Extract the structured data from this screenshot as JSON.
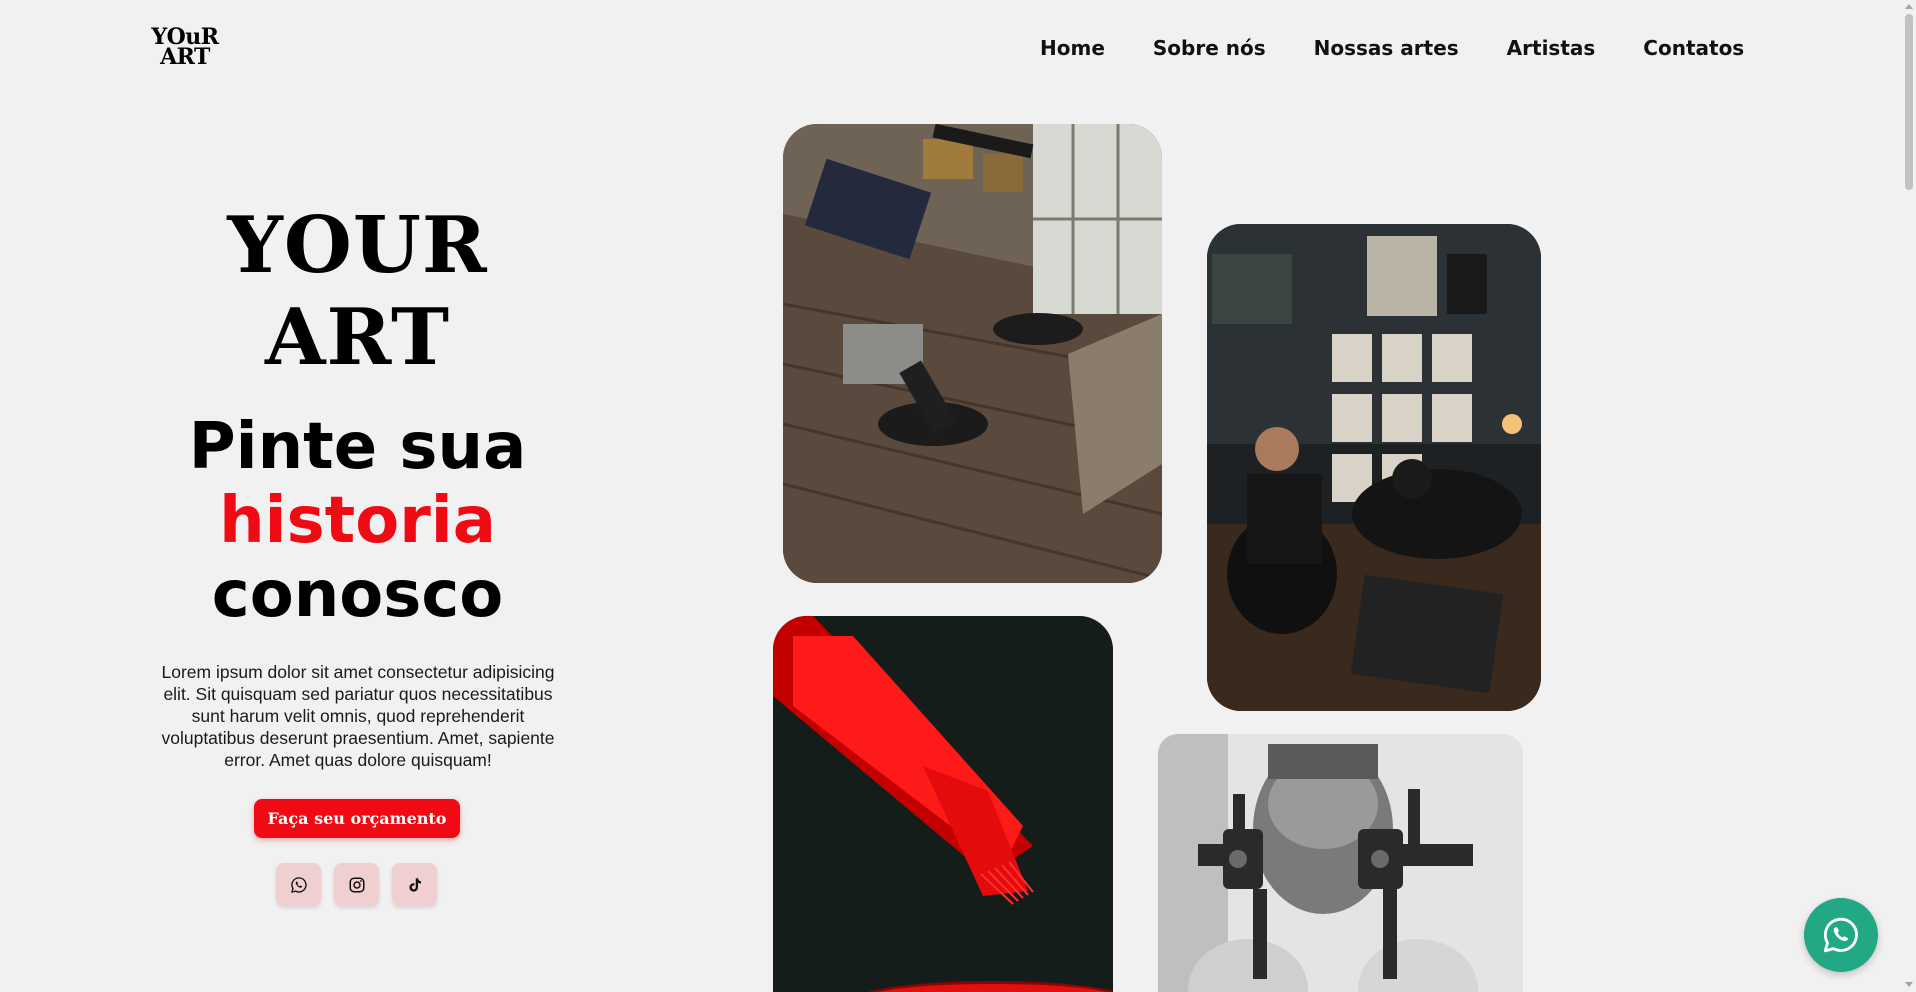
{
  "header": {
    "logo_line1": "YOuR",
    "logo_line2": "ART",
    "nav": [
      "Home",
      "Sobre nós",
      "Nossas artes",
      "Artistas",
      "Contatos"
    ]
  },
  "hero": {
    "brand_line1": "YOUR",
    "brand_line2": "ART",
    "tagline_line1": "Pinte sua",
    "tagline_accent": "historia",
    "tagline_line3": "conosco",
    "description": "Lorem ipsum dolor sit amet consectetur adipisicing elit. Sit quisquam sed pariatur quos necessitatibus sunt harum velit omnis, quod reprehenderit voluptatibus deserunt praesentium. Amet, sapiente error. Amet quas dolore quisquam!",
    "cta_label": "Faça seu orçamento"
  },
  "social": [
    "whatsapp-icon",
    "instagram-icon",
    "tiktok-icon"
  ],
  "gallery": [
    "tattoo-studio-photo",
    "tattoo-artists-photo",
    "tattoo-needle-photo",
    "tattoo-machine-photo"
  ],
  "colors": {
    "accent": "#ef0a14",
    "background": "#f1f1f1",
    "whatsapp": "#22a884",
    "social_bg": "#f0cfd0"
  }
}
